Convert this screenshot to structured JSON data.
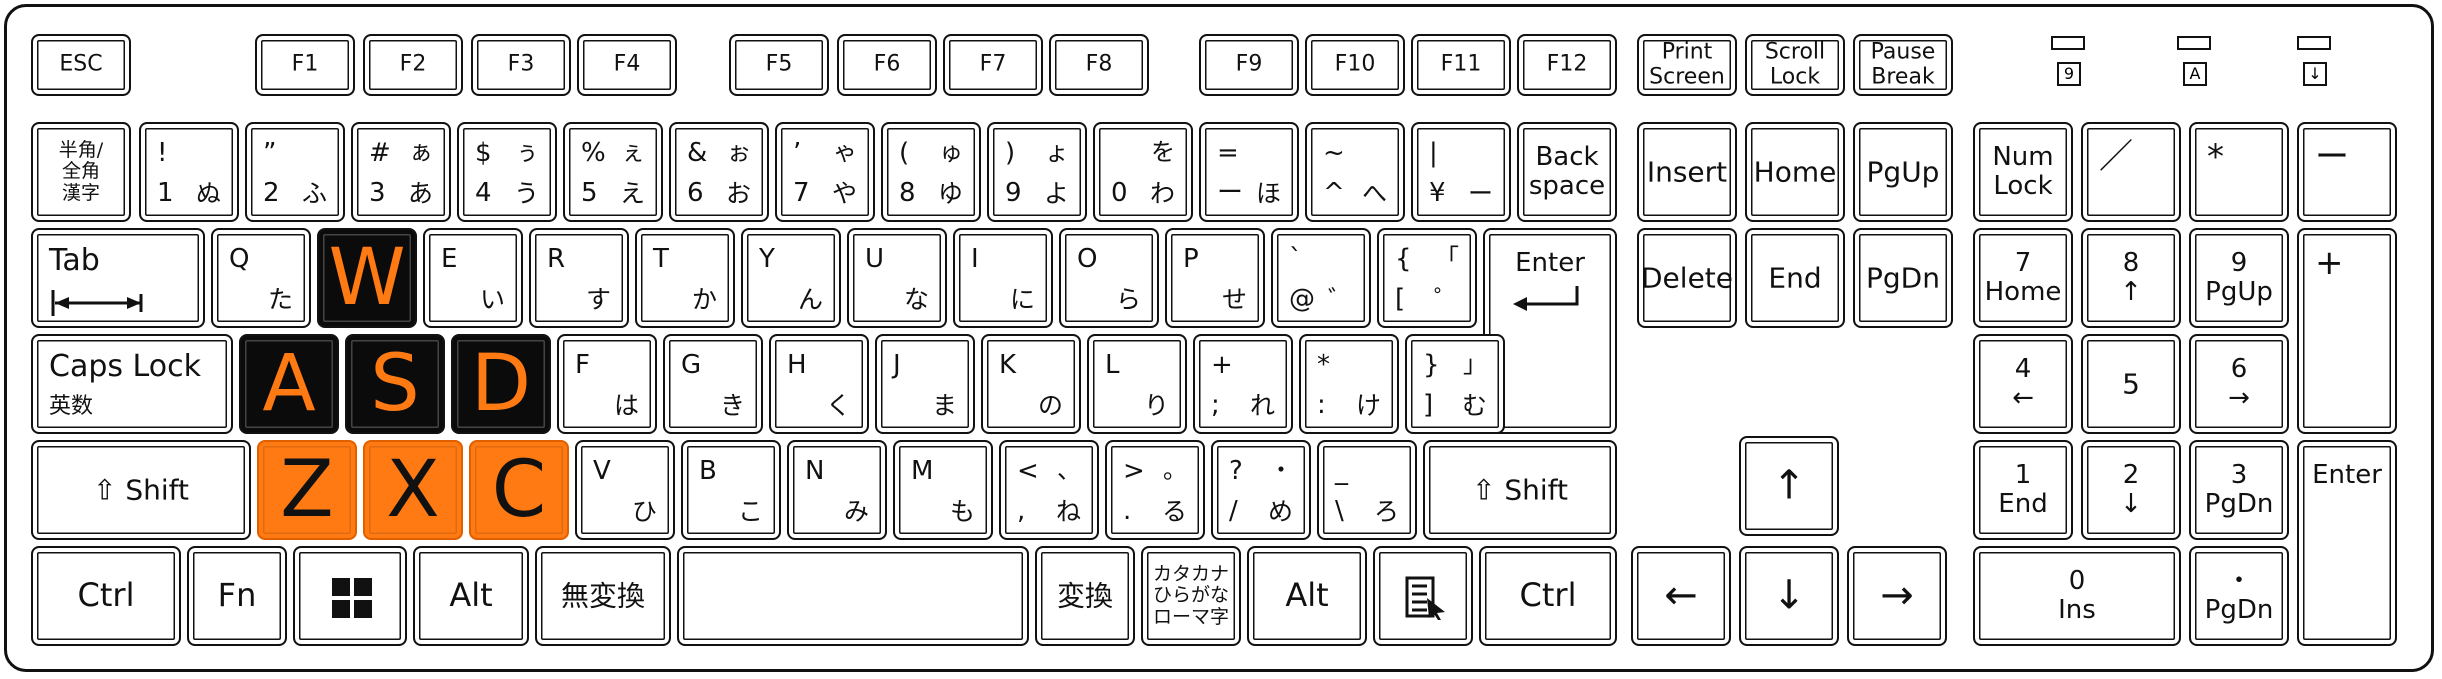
{
  "indicators": [
    {
      "label": "9"
    },
    {
      "label": "A"
    },
    {
      "label": "↓"
    }
  ],
  "highlight": {
    "dark_key_color": "#0b0b0b",
    "accent_color": "#ff7a12"
  },
  "keys": [
    {
      "name": "esc",
      "labels": {
        "c": "ESC"
      }
    },
    {
      "name": "f1",
      "labels": {
        "c": "F1"
      }
    },
    {
      "name": "f2",
      "labels": {
        "c": "F2"
      }
    },
    {
      "name": "f3",
      "labels": {
        "c": "F3"
      }
    },
    {
      "name": "f4",
      "labels": {
        "c": "F4"
      }
    },
    {
      "name": "f5",
      "labels": {
        "c": "F5"
      }
    },
    {
      "name": "f6",
      "labels": {
        "c": "F6"
      }
    },
    {
      "name": "f7",
      "labels": {
        "c": "F7"
      }
    },
    {
      "name": "f8",
      "labels": {
        "c": "F8"
      }
    },
    {
      "name": "f9",
      "labels": {
        "c": "F9"
      }
    },
    {
      "name": "f10",
      "labels": {
        "c": "F10"
      }
    },
    {
      "name": "f11",
      "labels": {
        "c": "F11"
      }
    },
    {
      "name": "f12",
      "labels": {
        "c": "F12"
      }
    },
    {
      "name": "print-screen",
      "labels": {
        "c": "Print\nScreen"
      }
    },
    {
      "name": "scroll-lock",
      "labels": {
        "c": "Scroll\nLock"
      }
    },
    {
      "name": "pause-break",
      "labels": {
        "c": "Pause\nBreak"
      }
    },
    {
      "name": "hankaku-zenkaku",
      "labels": {
        "c": "半角/\n全角\n漢字"
      }
    },
    {
      "name": "1",
      "labels": {
        "tl": "!",
        "bl": "1",
        "br": "ぬ"
      }
    },
    {
      "name": "2",
      "labels": {
        "tl": "”",
        "bl": "2",
        "br": "ふ"
      }
    },
    {
      "name": "3",
      "labels": {
        "tl": "#",
        "tr": "ぁ",
        "bl": "3",
        "br": "あ"
      }
    },
    {
      "name": "4",
      "labels": {
        "tl": "$",
        "tr": "ぅ",
        "bl": "4",
        "br": "う"
      }
    },
    {
      "name": "5",
      "labels": {
        "tl": "%",
        "tr": "ぇ",
        "bl": "5",
        "br": "え"
      }
    },
    {
      "name": "6",
      "labels": {
        "tl": "&",
        "tr": "ぉ",
        "bl": "6",
        "br": "お"
      }
    },
    {
      "name": "7",
      "labels": {
        "tl": "’",
        "tr": "ゃ",
        "bl": "7",
        "br": "や"
      }
    },
    {
      "name": "8",
      "labels": {
        "tl": "(",
        "tr": "ゅ",
        "bl": "8",
        "br": "ゆ"
      }
    },
    {
      "name": "9",
      "labels": {
        "tl": ")",
        "tr": "ょ",
        "bl": "9",
        "br": "よ"
      }
    },
    {
      "name": "0",
      "labels": {
        "tr": "を",
        "bl": "0",
        "br": "わ"
      }
    },
    {
      "name": "minus",
      "labels": {
        "tl": "=",
        "bl": "ー",
        "br": "ほ"
      }
    },
    {
      "name": "caret",
      "labels": {
        "tl": "~",
        "bl": "^",
        "br": "へ"
      }
    },
    {
      "name": "yen",
      "labels": {
        "tl": "|",
        "bl": "¥",
        "br": "ー"
      }
    },
    {
      "name": "backspace",
      "labels": {
        "c": "Back\nspace"
      }
    },
    {
      "name": "insert",
      "labels": {
        "c": "Insert"
      }
    },
    {
      "name": "home",
      "labels": {
        "c": "Home"
      }
    },
    {
      "name": "pgup",
      "labels": {
        "c": "PgUp"
      }
    },
    {
      "name": "num-lock",
      "labels": {
        "c": "Num\nLock"
      }
    },
    {
      "name": "num-slash",
      "labels": {
        "tl": "／"
      }
    },
    {
      "name": "num-star",
      "labels": {
        "tl": "*"
      }
    },
    {
      "name": "num-minus",
      "labels": {
        "tl": "ー"
      }
    },
    {
      "name": "tab",
      "labels": {
        "tl": "Tab"
      }
    },
    {
      "name": "q",
      "labels": {
        "tl": "Q",
        "br": "た"
      }
    },
    {
      "name": "w",
      "labels": {
        "big": "W"
      }
    },
    {
      "name": "e",
      "labels": {
        "tl": "E",
        "br": "い"
      }
    },
    {
      "name": "r",
      "labels": {
        "tl": "R",
        "br": "す"
      }
    },
    {
      "name": "t",
      "labels": {
        "tl": "T",
        "br": "か"
      }
    },
    {
      "name": "y",
      "labels": {
        "tl": "Y",
        "br": "ん"
      }
    },
    {
      "name": "u",
      "labels": {
        "tl": "U",
        "br": "な"
      }
    },
    {
      "name": "i",
      "labels": {
        "tl": "I",
        "br": "に"
      }
    },
    {
      "name": "o",
      "labels": {
        "tl": "O",
        "br": "ら"
      }
    },
    {
      "name": "p",
      "labels": {
        "tl": "P",
        "br": "せ"
      }
    },
    {
      "name": "at",
      "labels": {
        "tl": "`",
        "bl": "@",
        "br": "゛"
      }
    },
    {
      "name": "bracket-open",
      "labels": {
        "tl": "{",
        "tr": "「",
        "bl": "[",
        "br": "゜"
      }
    },
    {
      "name": "enter",
      "labels": {
        "tc": "Enter"
      }
    },
    {
      "name": "delete",
      "labels": {
        "c": "Delete"
      }
    },
    {
      "name": "end",
      "labels": {
        "c": "End"
      }
    },
    {
      "name": "pgdn",
      "labels": {
        "c": "PgDn"
      }
    },
    {
      "name": "num-7",
      "labels": {
        "c": "7\nHome"
      }
    },
    {
      "name": "num-8",
      "labels": {
        "c": "8\n↑"
      }
    },
    {
      "name": "num-9",
      "labels": {
        "c": "9\nPgUp"
      }
    },
    {
      "name": "num-plus",
      "labels": {
        "tl": "+"
      }
    },
    {
      "name": "caps-lock",
      "labels": {
        "tl": "Caps Lock",
        "bl": "英数"
      }
    },
    {
      "name": "a",
      "labels": {
        "big": "A"
      }
    },
    {
      "name": "s",
      "labels": {
        "big": "S"
      }
    },
    {
      "name": "d",
      "labels": {
        "big": "D"
      }
    },
    {
      "name": "f",
      "labels": {
        "tl": "F",
        "br": "は"
      }
    },
    {
      "name": "g",
      "labels": {
        "tl": "G",
        "br": "き"
      }
    },
    {
      "name": "h",
      "labels": {
        "tl": "H",
        "br": "く"
      }
    },
    {
      "name": "j",
      "labels": {
        "tl": "J",
        "br": "ま"
      }
    },
    {
      "name": "k",
      "labels": {
        "tl": "K",
        "br": "の"
      }
    },
    {
      "name": "l",
      "labels": {
        "tl": "L",
        "br": "り"
      }
    },
    {
      "name": "semicolon",
      "labels": {
        "tl": "+",
        "bl": ";",
        "br": "れ"
      }
    },
    {
      "name": "colon",
      "labels": {
        "tl": "*",
        "bl": ":",
        "br": "け"
      }
    },
    {
      "name": "bracket-close",
      "labels": {
        "tl": "}",
        "tr": "」",
        "bl": "]",
        "br": "む"
      }
    },
    {
      "name": "num-4",
      "labels": {
        "c": "4\n←"
      }
    },
    {
      "name": "num-5",
      "labels": {
        "c": "5"
      }
    },
    {
      "name": "num-6",
      "labels": {
        "c": "6\n→"
      }
    },
    {
      "name": "left-shift",
      "labels": {
        "c": "⇧ Shift"
      }
    },
    {
      "name": "z",
      "labels": {
        "big": "Z"
      }
    },
    {
      "name": "x",
      "labels": {
        "big": "X"
      }
    },
    {
      "name": "c",
      "labels": {
        "big": "C"
      }
    },
    {
      "name": "v",
      "labels": {
        "tl": "V",
        "br": "ひ"
      }
    },
    {
      "name": "b",
      "labels": {
        "tl": "B",
        "br": "こ"
      }
    },
    {
      "name": "n",
      "labels": {
        "tl": "N",
        "br": "み"
      }
    },
    {
      "name": "m",
      "labels": {
        "tl": "M",
        "br": "も"
      }
    },
    {
      "name": "comma",
      "labels": {
        "tl": "<",
        "tr": "、",
        "bl": ",",
        "br": "ね"
      }
    },
    {
      "name": "period",
      "labels": {
        "tl": ">",
        "tr": "。",
        "bl": ".",
        "br": "る"
      }
    },
    {
      "name": "slash",
      "labels": {
        "tl": "?",
        "tr": "・",
        "bl": "/",
        "br": "め"
      }
    },
    {
      "name": "backslash",
      "labels": {
        "tl": "_",
        "bl": "\\",
        "br": "ろ"
      }
    },
    {
      "name": "right-shift",
      "labels": {
        "c": "⇧ Shift"
      }
    },
    {
      "name": "arrow-up",
      "labels": {
        "c": "↑"
      }
    },
    {
      "name": "num-1",
      "labels": {
        "c": "1\nEnd"
      }
    },
    {
      "name": "num-2",
      "labels": {
        "c": "2\n↓"
      }
    },
    {
      "name": "num-3",
      "labels": {
        "c": "3\nPgDn"
      }
    },
    {
      "name": "num-enter",
      "labels": {
        "tc": "Enter"
      }
    },
    {
      "name": "left-ctrl",
      "labels": {
        "c": "Ctrl"
      }
    },
    {
      "name": "fn",
      "labels": {
        "c": "Fn"
      }
    },
    {
      "name": "windows",
      "labels": {}
    },
    {
      "name": "left-alt",
      "labels": {
        "c": "Alt"
      }
    },
    {
      "name": "muhenkan",
      "labels": {
        "c": "無変換"
      }
    },
    {
      "name": "space",
      "labels": {}
    },
    {
      "name": "henkan",
      "labels": {
        "c": "変換"
      }
    },
    {
      "name": "katakana-hiragana",
      "labels": {
        "c": "カタカナ\nひらがな\nローマ字"
      }
    },
    {
      "name": "right-alt",
      "labels": {
        "c": "Alt"
      }
    },
    {
      "name": "menu",
      "labels": {}
    },
    {
      "name": "right-ctrl",
      "labels": {
        "c": "Ctrl"
      }
    },
    {
      "name": "arrow-left",
      "labels": {
        "c": "←"
      }
    },
    {
      "name": "arrow-down",
      "labels": {
        "c": "↓"
      }
    },
    {
      "name": "arrow-right",
      "labels": {
        "c": "→"
      }
    },
    {
      "name": "num-0",
      "labels": {
        "c": "0\nIns"
      }
    },
    {
      "name": "num-dot",
      "labels": {
        "c": "・\nPgDn"
      }
    }
  ]
}
